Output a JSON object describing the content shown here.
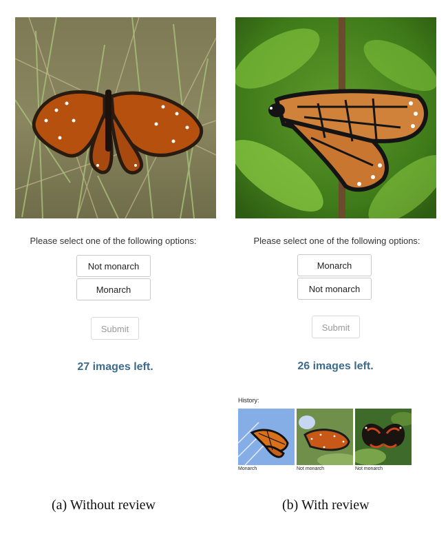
{
  "panel_a": {
    "prompt": "Please select one of the following options:",
    "options": [
      "Not monarch",
      "Monarch"
    ],
    "submit_label": "Submit",
    "images_left": "27 images left.",
    "caption": "(a)  Without review"
  },
  "panel_b": {
    "prompt": "Please select one of the following options:",
    "options": [
      "Monarch",
      "Not monarch"
    ],
    "submit_label": "Submit",
    "images_left": "26 images left.",
    "history_label": "History:",
    "history": [
      {
        "label": "Monarch"
      },
      {
        "label": "Not monarch"
      },
      {
        "label": "Not monarch"
      }
    ],
    "caption": "(b)  With review"
  },
  "colors": {
    "count_text": "#3d6b8c",
    "button_border": "#c9c9c9",
    "submit_text": "#9a9a9a"
  }
}
